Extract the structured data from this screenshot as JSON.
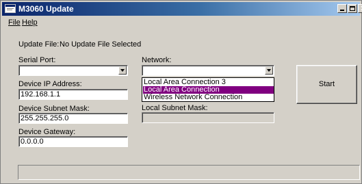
{
  "window": {
    "title": "M3060 Update"
  },
  "menu": {
    "file": "File",
    "help": "Help"
  },
  "update_file": {
    "label": "Update File:",
    "value": "No Update File Selected"
  },
  "serial_port": {
    "label": "Serial Port:",
    "value": ""
  },
  "device_ip": {
    "label": "Device IP Address:",
    "value": "192.168.1.1"
  },
  "device_subnet": {
    "label": "Device Subnet Mask:",
    "value": "255.255.255.0"
  },
  "device_gateway": {
    "label": "Device Gateway:",
    "value": "0.0.0.0"
  },
  "network": {
    "label": "Network:",
    "value": "",
    "options": [
      "Local Area Connection 3",
      "Local Area Connection",
      "Wireless Network Connection"
    ],
    "highlighted": "Local Area Connection"
  },
  "local_subnet": {
    "label": "Local Subnet Mask:",
    "value": ""
  },
  "start_button": {
    "label": "Start"
  },
  "status": {
    "text": ""
  },
  "colors": {
    "titlebar_start": "#0a246a",
    "titlebar_end": "#a6caf0",
    "selection": "#800080",
    "face": "#d4d0c8"
  },
  "icons": {
    "app": "app-window-icon",
    "minimize": "minimize-icon",
    "maximize": "maximize-icon",
    "close": "close-icon",
    "dropdown": "chevron-down-icon"
  }
}
